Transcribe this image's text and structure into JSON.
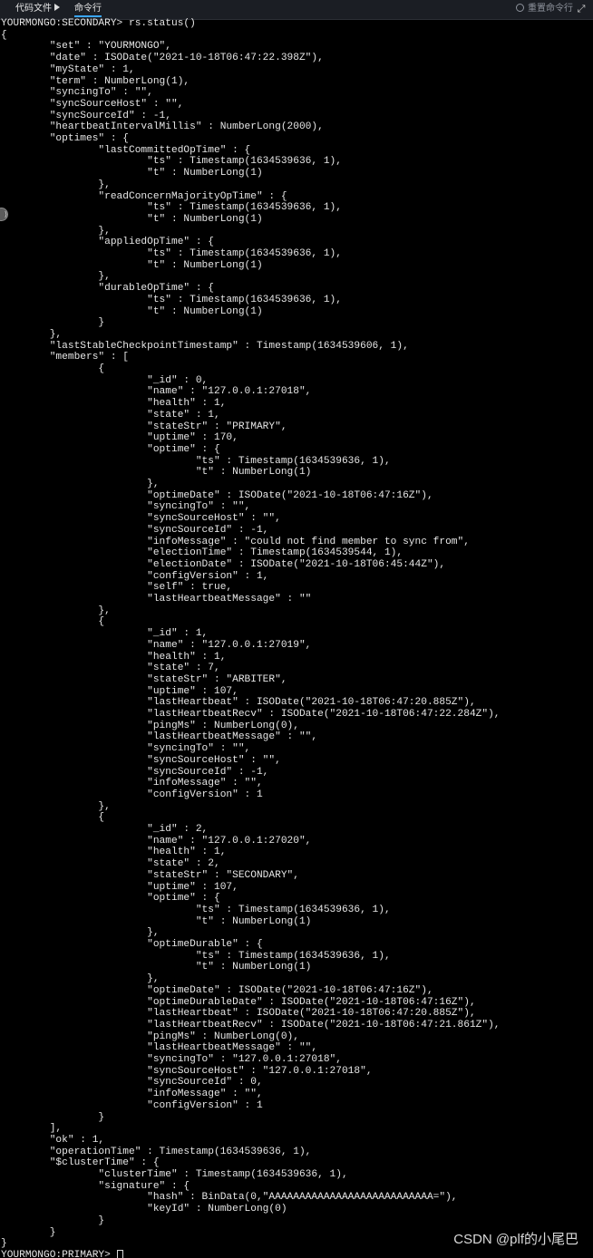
{
  "toolbar": {
    "code_tab_label": "代码文件",
    "cmd_tab_label": "命令行",
    "rerun_label": "重置命令行",
    "icons": {
      "code_tab": "play-icon",
      "rerun": "refresh-icon",
      "expand": "expand-icon"
    },
    "accent_color": "#3aa6ff"
  },
  "terminal": {
    "background": "#000000",
    "text_color": "#e6e6e6",
    "lines": [
      "YOURMONGO:SECONDARY> rs.status()",
      "{",
      "        \"set\" : \"YOURMONGO\",",
      "        \"date\" : ISODate(\"2021-10-18T06:47:22.398Z\"),",
      "        \"myState\" : 1,",
      "        \"term\" : NumberLong(1),",
      "        \"syncingTo\" : \"\",",
      "        \"syncSourceHost\" : \"\",",
      "        \"syncSourceId\" : -1,",
      "        \"heartbeatIntervalMillis\" : NumberLong(2000),",
      "        \"optimes\" : {",
      "                \"lastCommittedOpTime\" : {",
      "                        \"ts\" : Timestamp(1634539636, 1),",
      "                        \"t\" : NumberLong(1)",
      "                },",
      "                \"readConcernMajorityOpTime\" : {",
      "                        \"ts\" : Timestamp(1634539636, 1),",
      "                        \"t\" : NumberLong(1)",
      "                },",
      "                \"appliedOpTime\" : {",
      "                        \"ts\" : Timestamp(1634539636, 1),",
      "                        \"t\" : NumberLong(1)",
      "                },",
      "                \"durableOpTime\" : {",
      "                        \"ts\" : Timestamp(1634539636, 1),",
      "                        \"t\" : NumberLong(1)",
      "                }",
      "        },",
      "        \"lastStableCheckpointTimestamp\" : Timestamp(1634539606, 1),",
      "        \"members\" : [",
      "                {",
      "                        \"_id\" : 0,",
      "                        \"name\" : \"127.0.0.1:27018\",",
      "                        \"health\" : 1,",
      "                        \"state\" : 1,",
      "                        \"stateStr\" : \"PRIMARY\",",
      "                        \"uptime\" : 170,",
      "                        \"optime\" : {",
      "                                \"ts\" : Timestamp(1634539636, 1),",
      "                                \"t\" : NumberLong(1)",
      "                        },",
      "                        \"optimeDate\" : ISODate(\"2021-10-18T06:47:16Z\"),",
      "                        \"syncingTo\" : \"\",",
      "                        \"syncSourceHost\" : \"\",",
      "                        \"syncSourceId\" : -1,",
      "                        \"infoMessage\" : \"could not find member to sync from\",",
      "                        \"electionTime\" : Timestamp(1634539544, 1),",
      "                        \"electionDate\" : ISODate(\"2021-10-18T06:45:44Z\"),",
      "                        \"configVersion\" : 1,",
      "                        \"self\" : true,",
      "                        \"lastHeartbeatMessage\" : \"\"",
      "                },",
      "                {",
      "                        \"_id\" : 1,",
      "                        \"name\" : \"127.0.0.1:27019\",",
      "                        \"health\" : 1,",
      "                        \"state\" : 7,",
      "                        \"stateStr\" : \"ARBITER\",",
      "                        \"uptime\" : 107,",
      "                        \"lastHeartbeat\" : ISODate(\"2021-10-18T06:47:20.885Z\"),",
      "                        \"lastHeartbeatRecv\" : ISODate(\"2021-10-18T06:47:22.284Z\"),",
      "                        \"pingMs\" : NumberLong(0),",
      "                        \"lastHeartbeatMessage\" : \"\",",
      "                        \"syncingTo\" : \"\",",
      "                        \"syncSourceHost\" : \"\",",
      "                        \"syncSourceId\" : -1,",
      "                        \"infoMessage\" : \"\",",
      "                        \"configVersion\" : 1",
      "                },",
      "                {",
      "                        \"_id\" : 2,",
      "                        \"name\" : \"127.0.0.1:27020\",",
      "                        \"health\" : 1,",
      "                        \"state\" : 2,",
      "                        \"stateStr\" : \"SECONDARY\",",
      "                        \"uptime\" : 107,",
      "                        \"optime\" : {",
      "                                \"ts\" : Timestamp(1634539636, 1),",
      "                                \"t\" : NumberLong(1)",
      "                        },",
      "                        \"optimeDurable\" : {",
      "                                \"ts\" : Timestamp(1634539636, 1),",
      "                                \"t\" : NumberLong(1)",
      "                        },",
      "                        \"optimeDate\" : ISODate(\"2021-10-18T06:47:16Z\"),",
      "                        \"optimeDurableDate\" : ISODate(\"2021-10-18T06:47:16Z\"),",
      "                        \"lastHeartbeat\" : ISODate(\"2021-10-18T06:47:20.885Z\"),",
      "                        \"lastHeartbeatRecv\" : ISODate(\"2021-10-18T06:47:21.861Z\"),",
      "                        \"pingMs\" : NumberLong(0),",
      "                        \"lastHeartbeatMessage\" : \"\",",
      "                        \"syncingTo\" : \"127.0.0.1:27018\",",
      "                        \"syncSourceHost\" : \"127.0.0.1:27018\",",
      "                        \"syncSourceId\" : 0,",
      "                        \"infoMessage\" : \"\",",
      "                        \"configVersion\" : 1",
      "                }",
      "        ],",
      "        \"ok\" : 1,",
      "        \"operationTime\" : Timestamp(1634539636, 1),",
      "        \"$clusterTime\" : {",
      "                \"clusterTime\" : Timestamp(1634539636, 1),",
      "                \"signature\" : {",
      "                        \"hash\" : BinData(0,\"AAAAAAAAAAAAAAAAAAAAAAAAAAA=\"),",
      "                        \"keyId\" : NumberLong(0)",
      "                }",
      "        }",
      "}"
    ],
    "prompt": "YOURMONGO:PRIMARY> ",
    "prompt_input_value": ""
  },
  "watermark": {
    "text": "CSDN @plf的小尾巴"
  }
}
